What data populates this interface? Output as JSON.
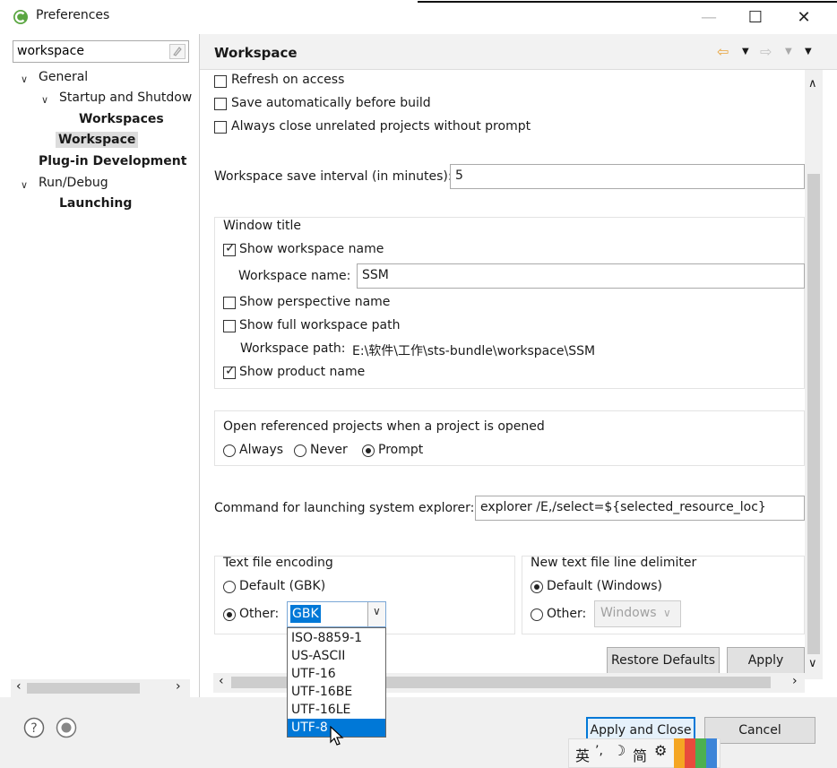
{
  "window": {
    "title": "Preferences",
    "controls": {
      "minimize": "—",
      "maximize": "☐",
      "close": "✕"
    }
  },
  "filter": {
    "value": "workspace"
  },
  "tree": {
    "general": "General",
    "startup": "Startup and Shutdow",
    "workspaces": "Workspaces",
    "workspace": "Workspace",
    "plugin_dev": "Plug-in Development",
    "run_debug": "Run/Debug",
    "launching": "Launching"
  },
  "page": {
    "title": "Workspace",
    "options": {
      "refresh_on_access": "Refresh on access",
      "save_before_build": "Save automatically before build",
      "close_unrelated": "Always close unrelated projects without prompt"
    },
    "save_interval": {
      "label": "Workspace save interval (in minutes):",
      "value": "5"
    },
    "window_title": {
      "group_label": "Window title",
      "show_workspace_name": "Show workspace name",
      "workspace_name_label": "Workspace name:",
      "workspace_name_value": "SSM",
      "show_perspective_name": "Show perspective name",
      "show_full_path": "Show full workspace path",
      "workspace_path_label": "Workspace path:",
      "workspace_path_value": "E:\\软件\\工作\\sts-bundle\\workspace\\SSM",
      "show_product_name": "Show product name"
    },
    "open_referenced": {
      "label": "Open referenced projects when a project is opened",
      "always": "Always",
      "never": "Never",
      "prompt": "Prompt"
    },
    "explorer": {
      "label": "Command for launching system explorer:",
      "value": "explorer /E,/select=${selected_resource_loc}"
    },
    "encoding": {
      "group_label": "Text file encoding",
      "default": "Default (GBK)",
      "other": "Other:",
      "other_value": "GBK",
      "options": [
        "ISO-8859-1",
        "US-ASCII",
        "UTF-16",
        "UTF-16BE",
        "UTF-16LE",
        "UTF-8"
      ]
    },
    "line_delimiter": {
      "group_label": "New text file line delimiter",
      "default": "Default (Windows)",
      "other": "Other:",
      "other_value": "Windows"
    },
    "restore_defaults": "Restore Defaults",
    "apply": "Apply"
  },
  "footer": {
    "apply_close": "Apply and Close",
    "cancel": "Cancel"
  },
  "ime": {
    "lang": "英",
    "mode": "简"
  },
  "colors": {
    "accent": "#0078d7",
    "eclipse_green": "#5aa641",
    "nav_arrow": "#e8a33c"
  }
}
